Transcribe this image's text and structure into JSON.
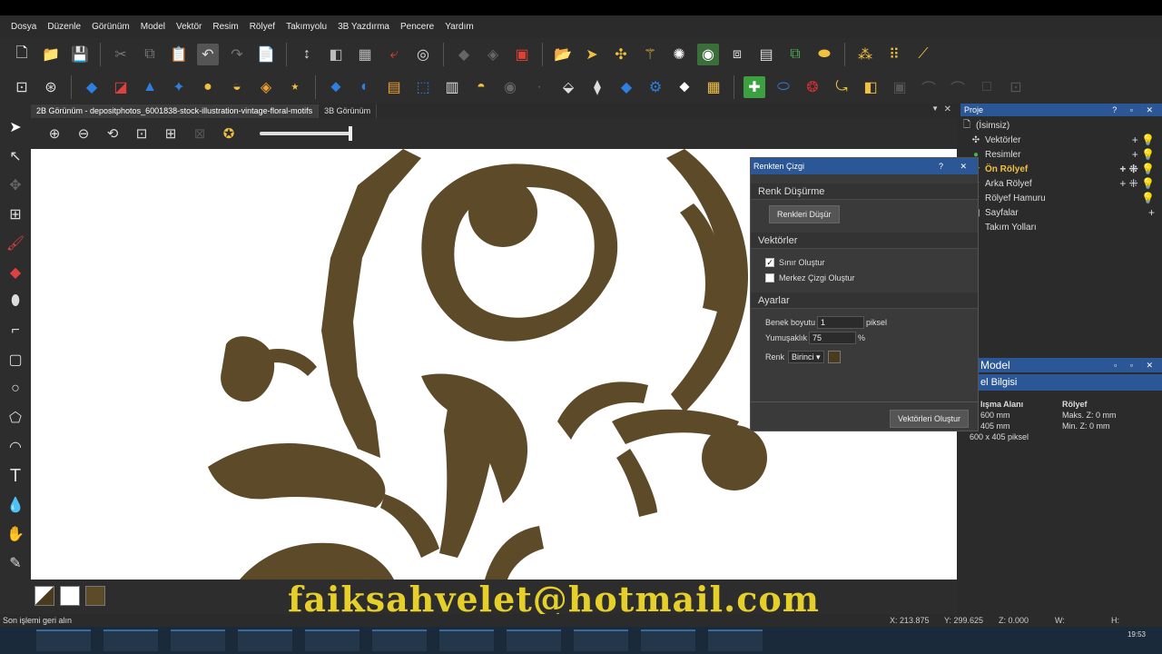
{
  "menu": [
    "Dosya",
    "Düzenle",
    "Görünüm",
    "Model",
    "Vektör",
    "Resim",
    "Rölyef",
    "Takımyolu",
    "3B Yazdırma",
    "Pencere",
    "Yardım"
  ],
  "tabs": {
    "active": "2B Görünüm - depositphotos_6001838-stock-illustration-vintage-floral-motifs",
    "second": "3B Görünüm",
    "menu_glyph": "▼",
    "close_glyph": "✕"
  },
  "project": {
    "title": "Proje",
    "header_btns": "? ▫ ✕",
    "root": "(İsimsiz)",
    "items": [
      {
        "label": "Vektörler",
        "right": "+ 💡"
      },
      {
        "label": "Resimler",
        "right": "+ 💡"
      },
      {
        "label": "Ön Rölyef",
        "right": "+ ⁜ 💡"
      },
      {
        "label": "Arka Rölyef",
        "right": "+ ⁜ 💡"
      },
      {
        "label": "Rölyef Hamuru",
        "right": "💡"
      },
      {
        "label": "Sayfalar",
        "right": "+"
      },
      {
        "label": "Takım Yolları",
        "right": ""
      }
    ]
  },
  "dialog": {
    "title": "Renkten Çizgi",
    "header_btns": "? ✕",
    "section_reduce": "Renk Düşürme",
    "reduce_button": "Renkleri Düşür",
    "section_vectors": "Vektörler",
    "boundary_label": "Sınır Oluştur",
    "boundary_checked": true,
    "center_label": "Merkez Çizgi Oluştur",
    "center_checked": false,
    "section_settings": "Ayarlar",
    "pixel_size_label": "Benek boyutu",
    "pixel_size_value": "1",
    "pixel_unit": "piksel",
    "smoothness_label": "Yumuşaklık",
    "smoothness_value": "75",
    "smoothness_unit": "%",
    "color_label": "Renk",
    "color_value": "Birinci",
    "create_button": "Vektörleri Oluştur"
  },
  "model_panel": {
    "title": "Model",
    "header_btns": "▫ ▫ ✕",
    "info_title": "el Bilgisi",
    "col1_title": "lışma Alanı",
    "col1_lines": [
      "600 mm",
      "405 mm",
      "600 x 405 piksel"
    ],
    "col2_title": "Rölyef",
    "col2_lines": [
      "Maks. Z: 0 mm",
      "Min. Z: 0 mm"
    ]
  },
  "status": {
    "message": "Son işlemi geri alın",
    "x": "X: 213.875",
    "y": "Y: 299.625",
    "z": "Z: 0.000",
    "w": "W:",
    "h": "H:"
  },
  "clock": "19:53",
  "overlay_text": "faiksahvelet@hotmail.com",
  "colors": {
    "motif": "#5c4a28",
    "accent_blue": "#2b5797",
    "overlay_yellow": "#e6cf2a"
  }
}
